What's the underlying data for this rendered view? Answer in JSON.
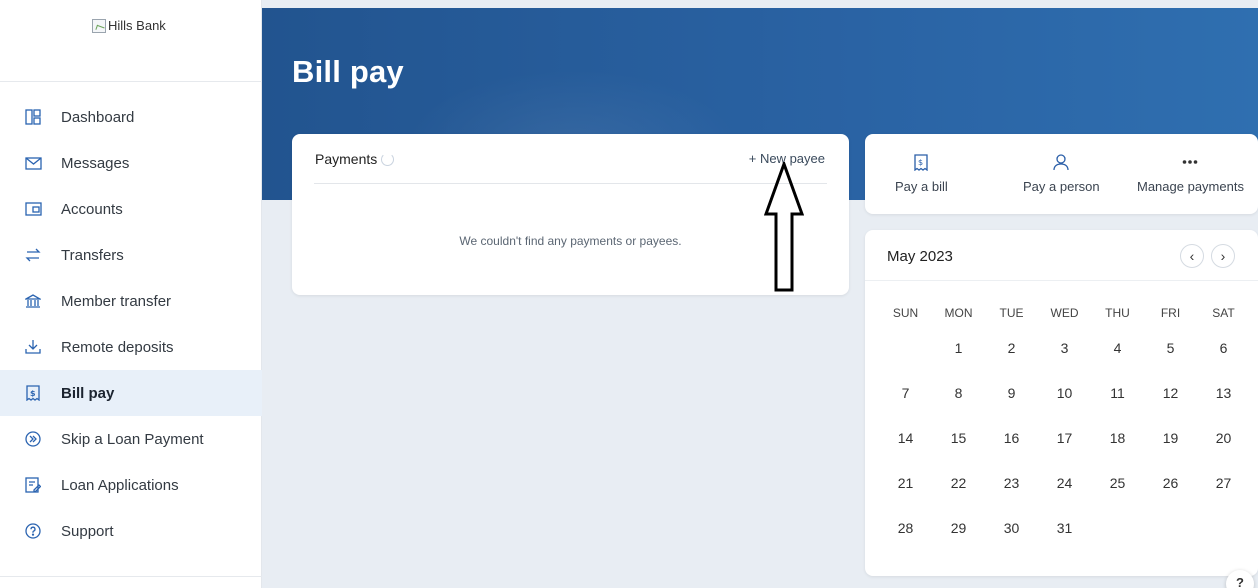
{
  "logo": {
    "alt_text": "Hills Bank"
  },
  "sidebar": {
    "items": [
      {
        "label": "Dashboard",
        "icon": "dashboard-icon"
      },
      {
        "label": "Messages",
        "icon": "envelope-icon"
      },
      {
        "label": "Accounts",
        "icon": "wallet-icon"
      },
      {
        "label": "Transfers",
        "icon": "transfer-arrows-icon"
      },
      {
        "label": "Member transfer",
        "icon": "bank-icon"
      },
      {
        "label": "Remote deposits",
        "icon": "download-tray-icon"
      },
      {
        "label": "Bill pay",
        "icon": "bill-icon",
        "active": true
      },
      {
        "label": "Skip a Loan Payment",
        "icon": "skip-forward-icon"
      },
      {
        "label": "Loan Applications",
        "icon": "form-edit-icon"
      },
      {
        "label": "Support",
        "icon": "help-circle-icon"
      }
    ]
  },
  "header": {
    "title": "Bill pay"
  },
  "payments": {
    "title": "Payments",
    "new_payee": "+ New payee",
    "empty_message": "We couldn't find any payments or payees."
  },
  "actions": [
    {
      "label": "Pay a bill",
      "icon": "bill-icon"
    },
    {
      "label": "Pay a person",
      "icon": "person-icon"
    },
    {
      "label": "Manage payments",
      "icon": "more-dots-icon"
    }
  ],
  "calendar": {
    "month_label": "May 2023",
    "weekdays": [
      "SUN",
      "MON",
      "TUE",
      "WED",
      "THU",
      "FRI",
      "SAT"
    ],
    "weeks": [
      [
        "",
        "1",
        "2",
        "3",
        "4",
        "5",
        "6"
      ],
      [
        "7",
        "8",
        "9",
        "10",
        "11",
        "12",
        "13"
      ],
      [
        "14",
        "15",
        "16",
        "17",
        "18",
        "19",
        "20"
      ],
      [
        "21",
        "22",
        "23",
        "24",
        "25",
        "26",
        "27"
      ],
      [
        "28",
        "29",
        "30",
        "31",
        "",
        "",
        ""
      ]
    ]
  },
  "help": {
    "label": "?"
  },
  "colors": {
    "header_blue": "#2a63a4",
    "accent": "#2a63b0",
    "active_nav_bg": "#e8f0f9"
  }
}
